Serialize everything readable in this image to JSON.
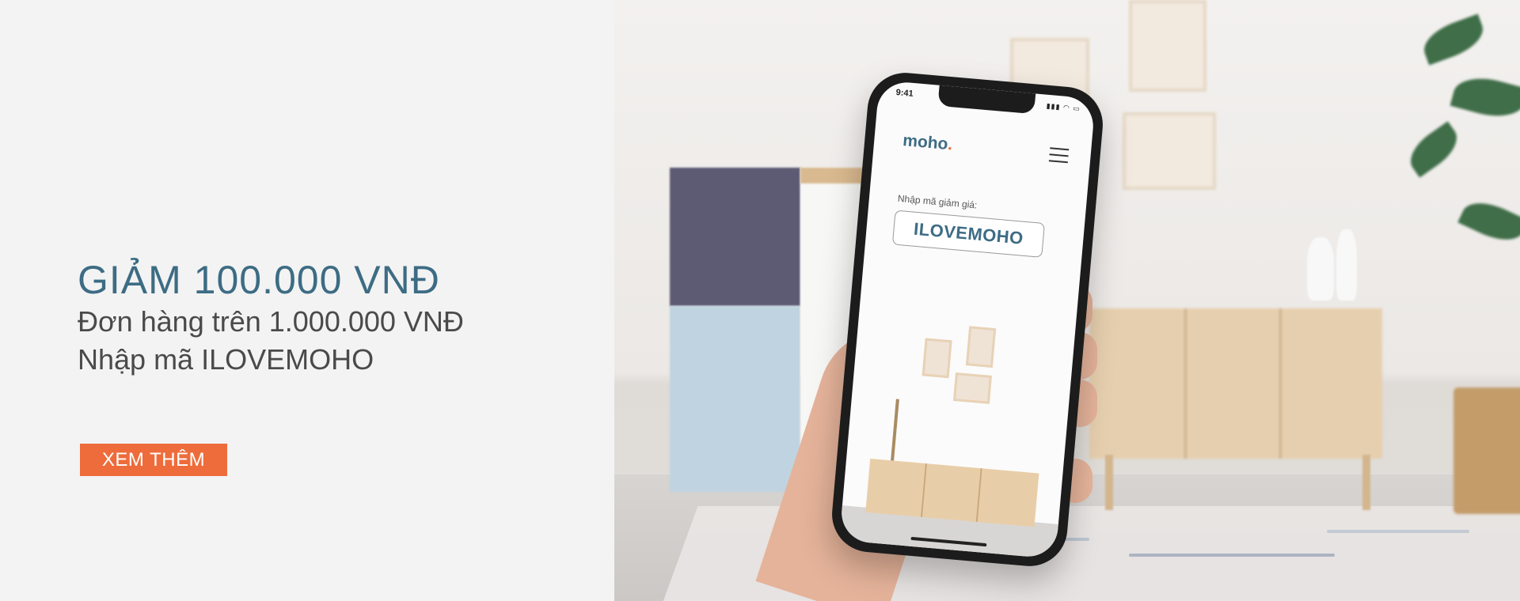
{
  "promo": {
    "headline": "GIẢM 100.000 VNĐ",
    "line1": "Đơn hàng trên 1.000.000 VNĐ",
    "line2": "Nhập mã ILOVEMOHO",
    "cta_label": "XEM THÊM"
  },
  "phone": {
    "status_time": "9:41",
    "status_icons": "▮▮▮ ◠ ▭",
    "logo_text": "moho",
    "logo_dot": ".",
    "menu_icon": "hamburger-menu-icon",
    "promo_label": "Nhập mã giảm giá:",
    "promo_code": "ILOVEMOHO"
  },
  "colors": {
    "brand_blue": "#3d6c84",
    "accent_orange": "#ee6c3b",
    "background": "#f3f3f3"
  }
}
